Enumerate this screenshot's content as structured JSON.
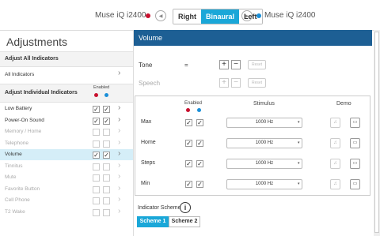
{
  "topbar": {
    "left_device": "Muse iQ i2400",
    "right_device": "Muse iQ i2400",
    "segments": [
      "Right",
      "Binaural",
      "Left"
    ],
    "active_segment": "Binaural",
    "red": "#c8102e",
    "blue": "#1a8fd8"
  },
  "left": {
    "title": "Adjustments",
    "section_all": "Adjust All Indicators",
    "all_indicators": "All Indicators",
    "section_individual": "Adjust Individual Indicators",
    "enabled_label": "Enabled",
    "items": [
      {
        "label": "Low Battery",
        "enabled": true,
        "checked": [
          true,
          true
        ]
      },
      {
        "label": "Power-On Sound",
        "enabled": true,
        "checked": [
          true,
          true
        ]
      },
      {
        "label": "Memory / Home",
        "enabled": false,
        "checked": [
          false,
          false
        ]
      },
      {
        "label": "Telephone",
        "enabled": false,
        "checked": [
          false,
          false
        ]
      },
      {
        "label": "Volume",
        "enabled": true,
        "checked": [
          true,
          true
        ],
        "selected": true
      },
      {
        "label": "Tinnitus",
        "enabled": false,
        "checked": [
          false,
          false
        ]
      },
      {
        "label": "Mute",
        "enabled": false,
        "checked": [
          false,
          false
        ]
      },
      {
        "label": "Favorite Button",
        "enabled": false,
        "checked": [
          false,
          false
        ]
      },
      {
        "label": "Cell Phone",
        "enabled": false,
        "checked": [
          false,
          false
        ]
      },
      {
        "label": "T2 Wake",
        "enabled": false,
        "checked": [
          false,
          false
        ]
      }
    ]
  },
  "right": {
    "header": "Volume",
    "tone_label": "Tone",
    "tone_value": "=",
    "speech_label": "Speech",
    "reset_label": "Reset",
    "plus": "+",
    "minus": "−",
    "cols": {
      "enabled": "Enabled",
      "stimulus": "Stimulus",
      "demo": "Demo"
    },
    "rows": [
      {
        "label": "Max",
        "stimulus": "1000 Hz"
      },
      {
        "label": "Home",
        "stimulus": "1000 Hz"
      },
      {
        "label": "Steps",
        "stimulus": "1000 Hz"
      },
      {
        "label": "Min",
        "stimulus": "1000 Hz"
      }
    ],
    "scheme_label": "Indicator Scheme",
    "info": "i",
    "schemes": [
      "Scheme 1",
      "Scheme 2"
    ],
    "active_scheme": "Scheme 1"
  },
  "icons": {
    "check": "✓",
    "chevron": "›",
    "caret": "▾"
  }
}
